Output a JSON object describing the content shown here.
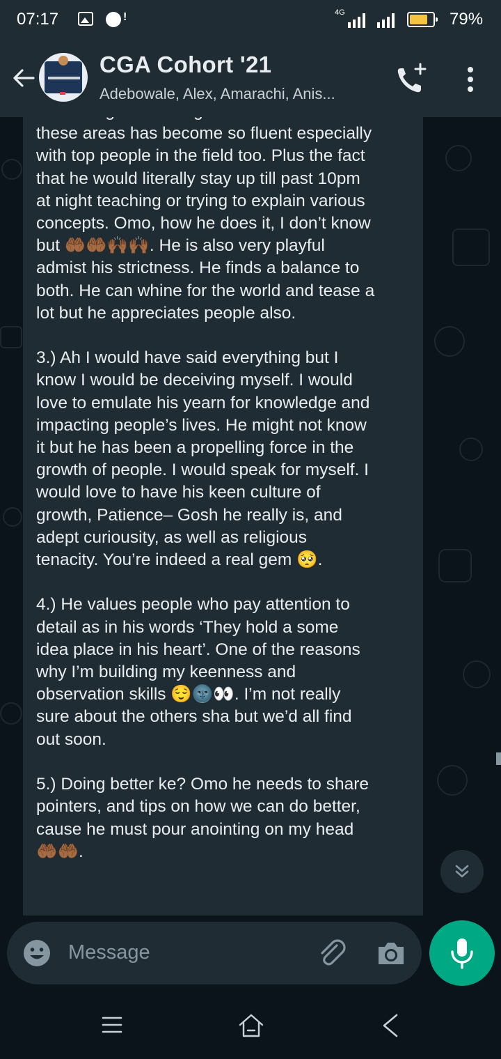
{
  "status_bar": {
    "time": "07:17",
    "network": "4G",
    "battery_percent": "79%",
    "battery_level": 0.79
  },
  "header": {
    "title": "CGA Cohort '21",
    "subtitle": "Adebowale, Alex, Amarachi, Anis..."
  },
  "message": {
    "text": "interesting that having conversations in\nthese areas has become so fluent especially\nwith top people in the field too. Plus the fact\nthat he would literally stay up till past 10pm\nat night teaching or trying to explain various\nconcepts. Omo, how he does it, I don’t know\nbut 🤲🏾🤲🏾🙌🏾🙌🏾. He is also very playful\nadmist his strictness. He finds a balance to\nboth. He can whine for the world and tease a\nlot but he appreciates people also.\n\n3.) Ah I would have said everything but I\nknow I would be deceiving myself. I would\nlove to emulate his yearn for knowledge and\nimpacting people’s lives. He might not know\nit but he has been a propelling force in the\ngrowth of people. I would speak for myself. I\nwould love to have his keen culture of\ngrowth, Patience– Gosh he really is, and\nadept curiousity, as well as religious\ntenacity. You’re indeed a real gem 🥺.\n\n4.) He values people who pay attention to\ndetail as in his words ‘They hold a some\nidea place in his heart’. One of the reasons\nwhy I’m building my keenness and\nobservation skills 😌🌚👀. I’m not really\nsure about the others sha but we’d all find\nout soon.\n\n5.) Doing better ke? Omo he needs to share\npointers, and tips on how we can do better,\ncause he must pour anointing on my head\n🤲🏾🤲🏾."
  },
  "composer": {
    "placeholder": "Message"
  },
  "colors": {
    "header_bg": "#1f2c33",
    "chat_bg": "#0b141a",
    "bubble_bg": "#1f2c33",
    "accent": "#00a884"
  }
}
